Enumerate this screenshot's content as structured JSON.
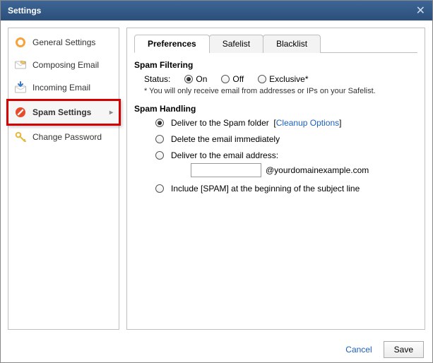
{
  "title": "Settings",
  "sidebar": {
    "items": [
      {
        "label": "General Settings"
      },
      {
        "label": "Composing Email"
      },
      {
        "label": "Incoming Email"
      },
      {
        "label": "Spam Settings"
      },
      {
        "label": "Change Password"
      }
    ]
  },
  "tabs": [
    {
      "label": "Preferences"
    },
    {
      "label": "Safelist"
    },
    {
      "label": "Blacklist"
    }
  ],
  "filter": {
    "heading": "Spam Filtering",
    "status_label": "Status:",
    "options": {
      "on": "On",
      "off": "Off",
      "exclusive": "Exclusive*"
    },
    "note": "* You will only receive email from addresses or IPs on your Safelist."
  },
  "handling": {
    "heading": "Spam Handling",
    "opt1": "Deliver to the Spam folder",
    "opt1_link": "Cleanup Options",
    "opt2": "Delete the email immediately",
    "opt3": "Deliver to the email address:",
    "opt3_domain": "@yourdomainexample.com",
    "opt4": "Include [SPAM] at the beginning of the subject line"
  },
  "footer": {
    "cancel": "Cancel",
    "save": "Save"
  }
}
